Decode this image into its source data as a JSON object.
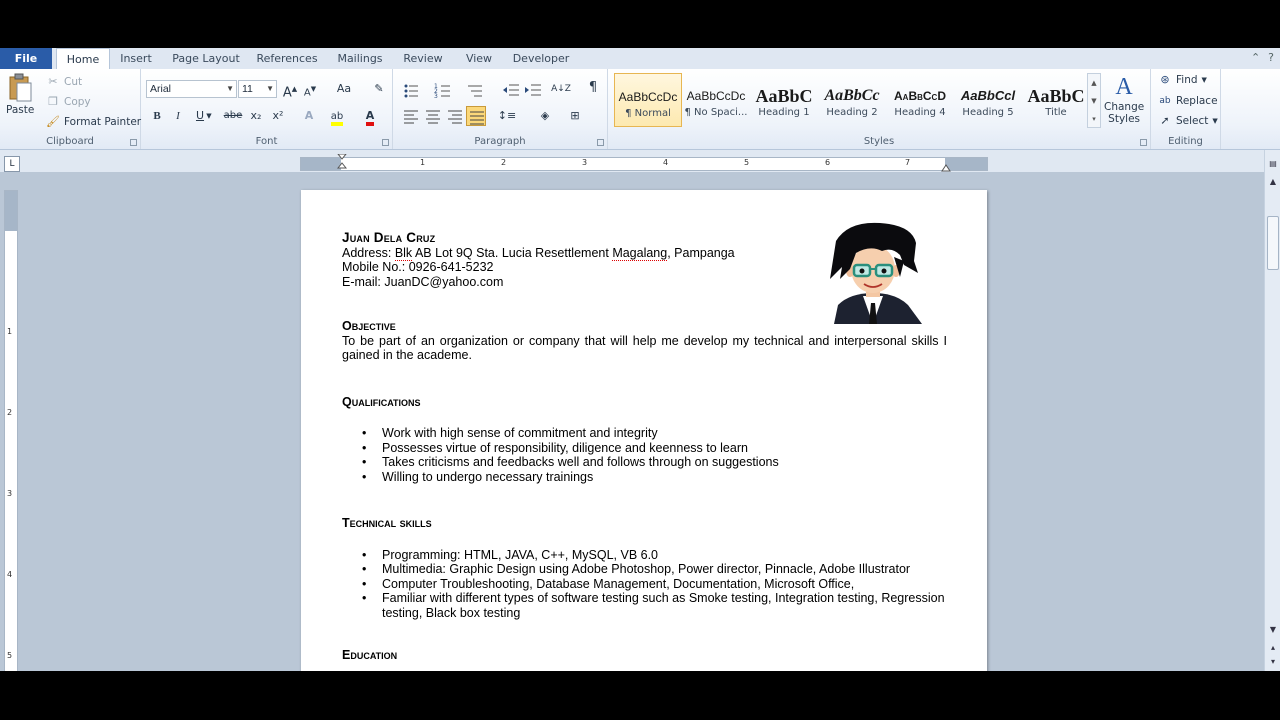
{
  "tabs": {
    "file": "File",
    "items": [
      "Home",
      "Insert",
      "Page Layout",
      "References",
      "Mailings",
      "Review",
      "View",
      "Developer"
    ]
  },
  "clipboard": {
    "paste": "Paste",
    "cut": "Cut",
    "copy": "Copy",
    "format_painter": "Format Painter",
    "label": "Clipboard"
  },
  "font": {
    "family": "Arial",
    "size": "11",
    "bold": "B",
    "italic": "I",
    "underline": "U",
    "strike": "abe",
    "subscript": "x₂",
    "superscript": "x²",
    "grow": "A",
    "shrink": "A",
    "change_case": "Aa",
    "label": "Font"
  },
  "paragraph": {
    "label": "Paragraph",
    "pilcrow": "¶"
  },
  "styles": {
    "items": [
      {
        "sample": "AaBbCcDc",
        "name": "¶ Normal"
      },
      {
        "sample": "AaBbCcDc",
        "name": "¶ No Spaci..."
      },
      {
        "sample": "AaBbC",
        "name": "Heading 1"
      },
      {
        "sample": "AaBbCc",
        "name": "Heading 2"
      },
      {
        "sample": "AaBbCcD",
        "name": "Heading 4"
      },
      {
        "sample": "AaBbCcl",
        "name": "Heading 5"
      },
      {
        "sample": "AaBbC",
        "name": "Title"
      }
    ],
    "change_styles_line1": "Change",
    "change_styles_line2": "Styles",
    "label": "Styles"
  },
  "editing": {
    "find": "Find",
    "replace": "Replace",
    "select": "Select",
    "label": "Editing"
  },
  "ruler": {
    "numbers": [
      "1",
      "2",
      "3",
      "4",
      "5",
      "6",
      "7"
    ],
    "vertical_numbers": [
      "1",
      "2",
      "3",
      "4",
      "5"
    ]
  },
  "document": {
    "name": "Juan Dela Cruz",
    "address_prefix": "Address: ",
    "address_blk": "Blk",
    "address_mid": " AB Lot 9Q Sta. Lucia Resettlement ",
    "address_magalang": "Magalang",
    "address_end": ", Pampanga",
    "mobile": "Mobile No.: 0926-641-5232",
    "email": "E-mail: JuanDC@yahoo.com",
    "objective_heading": "Objective",
    "objective_text": "To be part of an organization or company that will help me develop my technical and interpersonal skills I gained in the academe.",
    "qualifications_heading": "Qualifications",
    "qualifications": [
      "Work with high sense of commitment and integrity",
      "Possesses virtue of responsibility, diligence and keenness to learn",
      "Takes criticisms and feedbacks well and follows through on suggestions",
      "Willing to undergo necessary trainings"
    ],
    "technical_heading": "Technical skills",
    "technical": [
      "Programming: HTML, JAVA, C++, MySQL,  VB 6.0",
      "Multimedia: Graphic Design using Adobe Photoshop, Power director, Pinnacle, Adobe Illustrator",
      "Computer Troubleshooting, Database Management, Documentation, Microsoft Office,",
      "Familiar with different types of software testing such as Smoke testing, Integration testing, Regression testing, Black box testing"
    ],
    "education_heading": "Education"
  }
}
